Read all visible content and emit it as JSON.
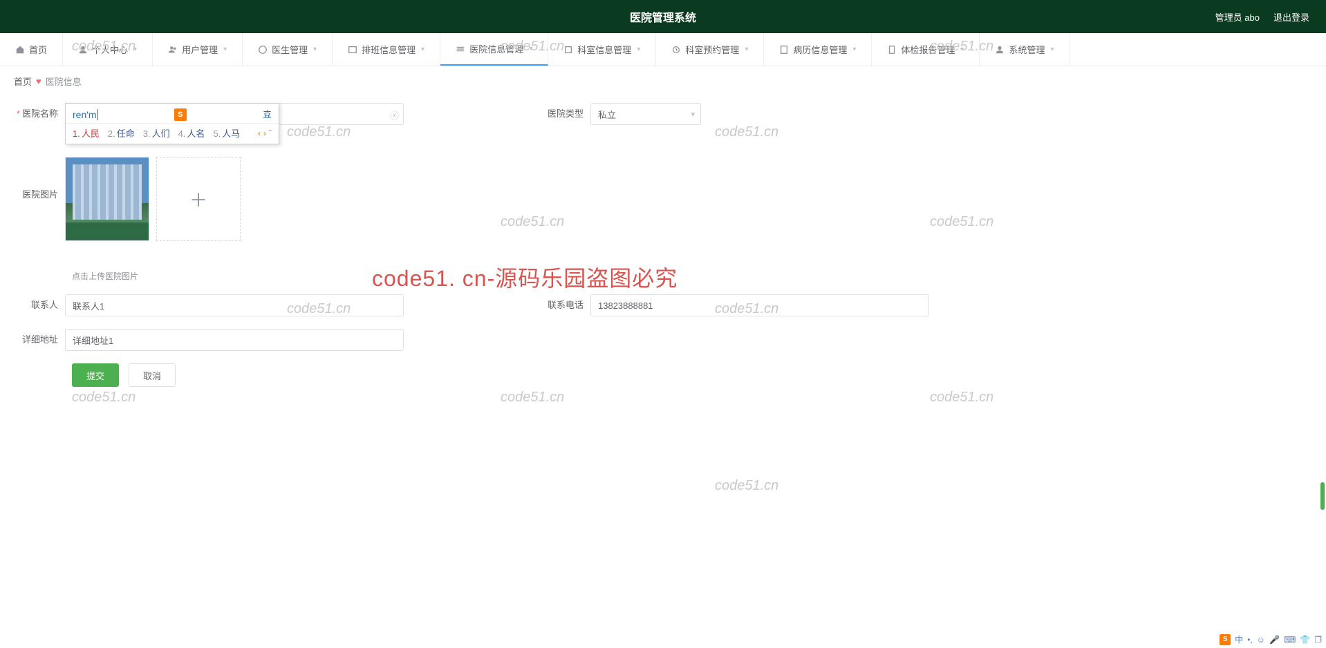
{
  "header": {
    "title": "医院管理系统",
    "user_label": "管理员 abo",
    "logout": "退出登录"
  },
  "nav": [
    {
      "label": "首页",
      "icon": "home",
      "caret": false
    },
    {
      "label": "个人中心",
      "icon": "user",
      "caret": true
    },
    {
      "label": "用户管理",
      "icon": "users",
      "caret": true
    },
    {
      "label": "医生管理",
      "icon": "doctor",
      "caret": true
    },
    {
      "label": "排班信息管理",
      "icon": "schedule",
      "caret": true
    },
    {
      "label": "医院信息管理",
      "icon": "hospital",
      "caret": true,
      "active": true
    },
    {
      "label": "科室信息管理",
      "icon": "dept",
      "caret": true
    },
    {
      "label": "科室预约管理",
      "icon": "appt",
      "caret": true
    },
    {
      "label": "病历信息管理",
      "icon": "record",
      "caret": true
    },
    {
      "label": "体检报告管理",
      "icon": "report",
      "caret": true
    },
    {
      "label": "系统管理",
      "icon": "system",
      "caret": true
    }
  ],
  "breadcrumb": {
    "home": "首页",
    "current": "医院信息"
  },
  "form": {
    "name_label": "医院名称",
    "name_value": "renm",
    "type_label": "医院类型",
    "type_value": "私立",
    "image_label": "医院图片",
    "upload_hint": "点击上传医院图片",
    "contact_label": "联系人",
    "contact_value": "联系人1",
    "phone_label": "联系电话",
    "phone_value": "13823888881",
    "address_label": "详细地址",
    "address_value": "详细地址1",
    "submit": "提交",
    "cancel": "取消"
  },
  "ime": {
    "composition": "ren'm",
    "candidates": [
      {
        "n": "1.",
        "w": "人民"
      },
      {
        "n": "2.",
        "w": "任命"
      },
      {
        "n": "3.",
        "w": "人们"
      },
      {
        "n": "4.",
        "w": "人名"
      },
      {
        "n": "5.",
        "w": "人马"
      }
    ]
  },
  "watermarks": {
    "text": "code51.cn",
    "red": "code51. cn-源码乐园盗图必究"
  },
  "tray": {
    "lang": "中"
  }
}
